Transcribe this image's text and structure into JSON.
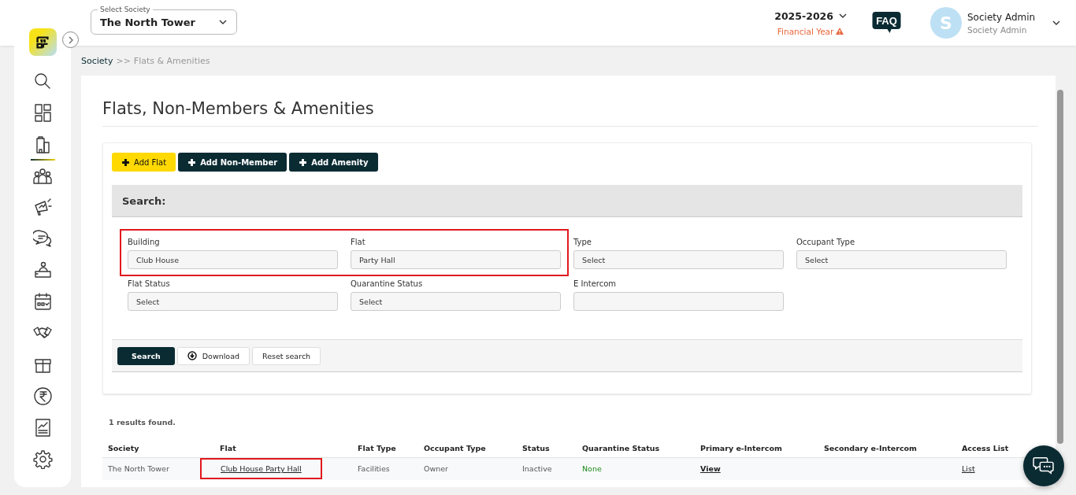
{
  "header": {
    "society_select": {
      "label": "Select Society",
      "value": "The North Tower"
    },
    "year": "2025-2026",
    "year_caption": "Financial Year",
    "faq": "FAQ",
    "user": {
      "initial": "S",
      "name": "Society Admin",
      "role": "Society Admin"
    }
  },
  "sidebar": {
    "items": [
      {
        "kind": "search",
        "selected": false
      },
      {
        "kind": "dashboard",
        "selected": false
      },
      {
        "kind": "building",
        "selected": true
      },
      {
        "kind": "people",
        "selected": false
      },
      {
        "kind": "megaphone",
        "selected": false
      },
      {
        "kind": "chat",
        "selected": false
      },
      {
        "kind": "desk",
        "selected": false
      },
      {
        "kind": "calendar",
        "selected": false
      },
      {
        "kind": "handshake",
        "selected": false
      },
      {
        "kind": "box",
        "selected": false
      },
      {
        "kind": "rupee",
        "selected": false
      },
      {
        "kind": "report",
        "selected": false
      },
      {
        "kind": "settings",
        "selected": false
      }
    ]
  },
  "breadcrumb": [
    {
      "text": "Society",
      "current": false
    },
    {
      "text": ">>",
      "current": true
    },
    {
      "text": "Flats & Amenities",
      "current": true
    }
  ],
  "page_title": "Flats, Non-Members & Amenities",
  "actions": [
    {
      "label": "Add Flat",
      "kind": "primary"
    },
    {
      "label": "Add Non-Member",
      "kind": "dark"
    },
    {
      "label": "Add Amenity",
      "kind": "dark"
    }
  ],
  "search": {
    "title": "Search:",
    "fields": [
      {
        "label": "Building",
        "value": "Club House",
        "highlighted": true
      },
      {
        "label": "Flat",
        "value": "Party Hall",
        "highlighted": true
      },
      {
        "label": "Type",
        "value": "Select"
      },
      {
        "label": "Occupant Type",
        "value": "Select"
      },
      {
        "label": "Flat Status",
        "value": "Select"
      },
      {
        "label": "Quarantine Status",
        "value": "Select"
      },
      {
        "label": "E Intercom"
      }
    ],
    "buttons": [
      {
        "label": "Search",
        "kind": "dark"
      },
      {
        "label": "Download",
        "kind": "download"
      },
      {
        "label": "Reset search",
        "kind": "plain"
      }
    ]
  },
  "results_count": "1 results found.",
  "table": {
    "columns": [
      "Society",
      "Flat",
      "Flat Type",
      "Occupant Type",
      "Status",
      "Quarantine Status",
      "Primary e-Intercom",
      "Secondary e-Intercom",
      "Access List"
    ],
    "rows": [
      {
        "cells": [
          {
            "text": "The North Tower",
            "kind": "plain"
          },
          {
            "text": "Club House Party Hall",
            "kind": "link",
            "highlighted": true
          },
          {
            "text": "Facilities",
            "kind": "plain"
          },
          {
            "text": "Owner",
            "kind": "plain"
          },
          {
            "text": "Inactive",
            "kind": "plain"
          },
          {
            "text": "None",
            "kind": "good"
          },
          {
            "text": "View",
            "kind": "strong-link"
          },
          {
            "kind": "empty"
          },
          {
            "text": "List",
            "kind": "link"
          }
        ]
      }
    ]
  }
}
